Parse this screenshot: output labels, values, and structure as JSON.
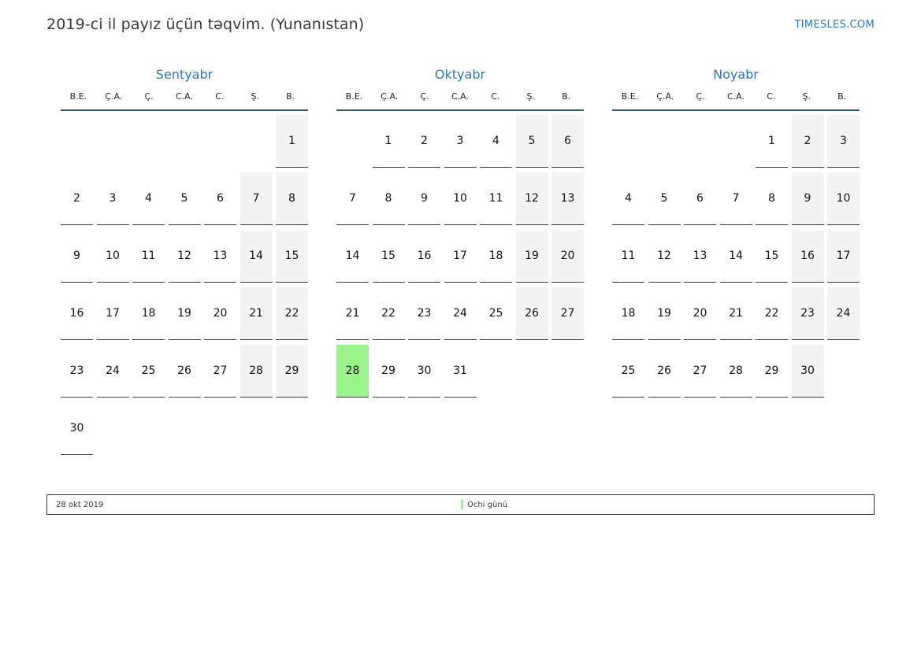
{
  "header": {
    "title": "2019-ci il payız üçün təqvim. (Yunanıstan)",
    "brand": "TIMESLES.COM"
  },
  "weekdays": [
    "B.E.",
    "Ç.A.",
    "Ç.",
    "C.A.",
    "C.",
    "Ş.",
    "B."
  ],
  "months": [
    {
      "name": "Sentyabr",
      "offset": 6,
      "days": [
        "1",
        "2",
        "3",
        "4",
        "5",
        "6",
        "7",
        "8",
        "9",
        "10",
        "11",
        "12",
        "13",
        "14",
        "15",
        "16",
        "17",
        "18",
        "19",
        "20",
        "21",
        "22",
        "23",
        "24",
        "25",
        "26",
        "27",
        "28",
        "29",
        "30"
      ]
    },
    {
      "name": "Oktyabr",
      "offset": 1,
      "days": [
        "1",
        "2",
        "3",
        "4",
        "5",
        "6",
        "7",
        "8",
        "9",
        "10",
        "11",
        "12",
        "13",
        "14",
        "15",
        "16",
        "17",
        "18",
        "19",
        "20",
        "21",
        "22",
        "23",
        "24",
        "25",
        "26",
        "27",
        "28",
        "29",
        "30",
        "31"
      ]
    },
    {
      "name": "Noyabr",
      "offset": 4,
      "days": [
        "1",
        "2",
        "3",
        "4",
        "5",
        "6",
        "7",
        "8",
        "9",
        "10",
        "11",
        "12",
        "13",
        "14",
        "15",
        "16",
        "17",
        "18",
        "19",
        "20",
        "21",
        "22",
        "23",
        "24",
        "25",
        "26",
        "27",
        "28",
        "29",
        "30"
      ]
    }
  ],
  "holidays": [
    {
      "month": 1,
      "day": 28,
      "color": "#99f589"
    }
  ],
  "legend": {
    "date": "28 okt 2019",
    "name": "Ochi günü",
    "color": "#99f589"
  },
  "colors": {
    "accent": "#2e78b7",
    "weekend_bg": "#f3f3f3",
    "header_rule": "#3e5678"
  }
}
